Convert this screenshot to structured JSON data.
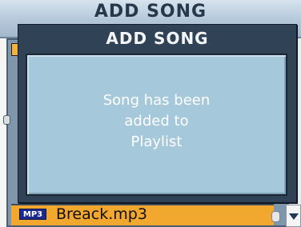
{
  "background": {
    "title": "ADD SONG",
    "song_row": {
      "format_badge": "MP3",
      "song_name": "Breack.mp3"
    }
  },
  "dialog": {
    "title": "ADD SONG",
    "message_lines": [
      "Song has been",
      "added to",
      "Playlist"
    ]
  },
  "colors": {
    "dialog_frame": "#2f4256",
    "dialog_body": "#a5c8da",
    "selected_row": "#f2a72f",
    "badge": "#1c2a8f"
  },
  "icons": {
    "scroll_down": "triangle-down-icon"
  }
}
